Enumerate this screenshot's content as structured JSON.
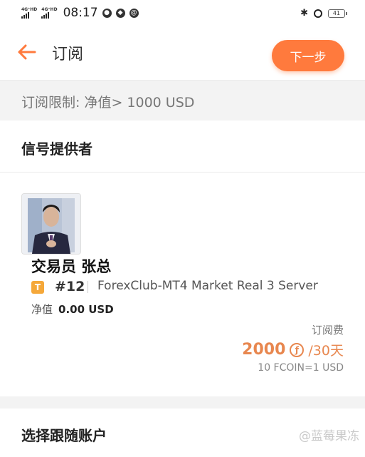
{
  "status_bar": {
    "network1": "4G⁺HD",
    "network2": "4G⁺HD",
    "time": "08:17",
    "battery": "41"
  },
  "header": {
    "title": "订阅",
    "next_label": "下一步"
  },
  "subscription_limit": "订阅限制: 净值> 1000 USD",
  "signal_section": {
    "title": "信号提供者"
  },
  "trader": {
    "name": "交易员 张总",
    "badge": "T",
    "account_number": "#12",
    "server": "ForexClub-MT4 Market Real 3 Server",
    "equity_label": "净值",
    "equity_value": "0.00 USD"
  },
  "fee": {
    "label": "订阅费",
    "amount": "2000",
    "period": "/30天",
    "rate": "10 FCOIN=1 USD"
  },
  "follow_section": {
    "title": "选择跟随账户"
  },
  "watermark": "@蓝莓果冻",
  "colors": {
    "accent": "#ff7a3d",
    "price": "#e8874f",
    "badge": "#f5a83a"
  }
}
